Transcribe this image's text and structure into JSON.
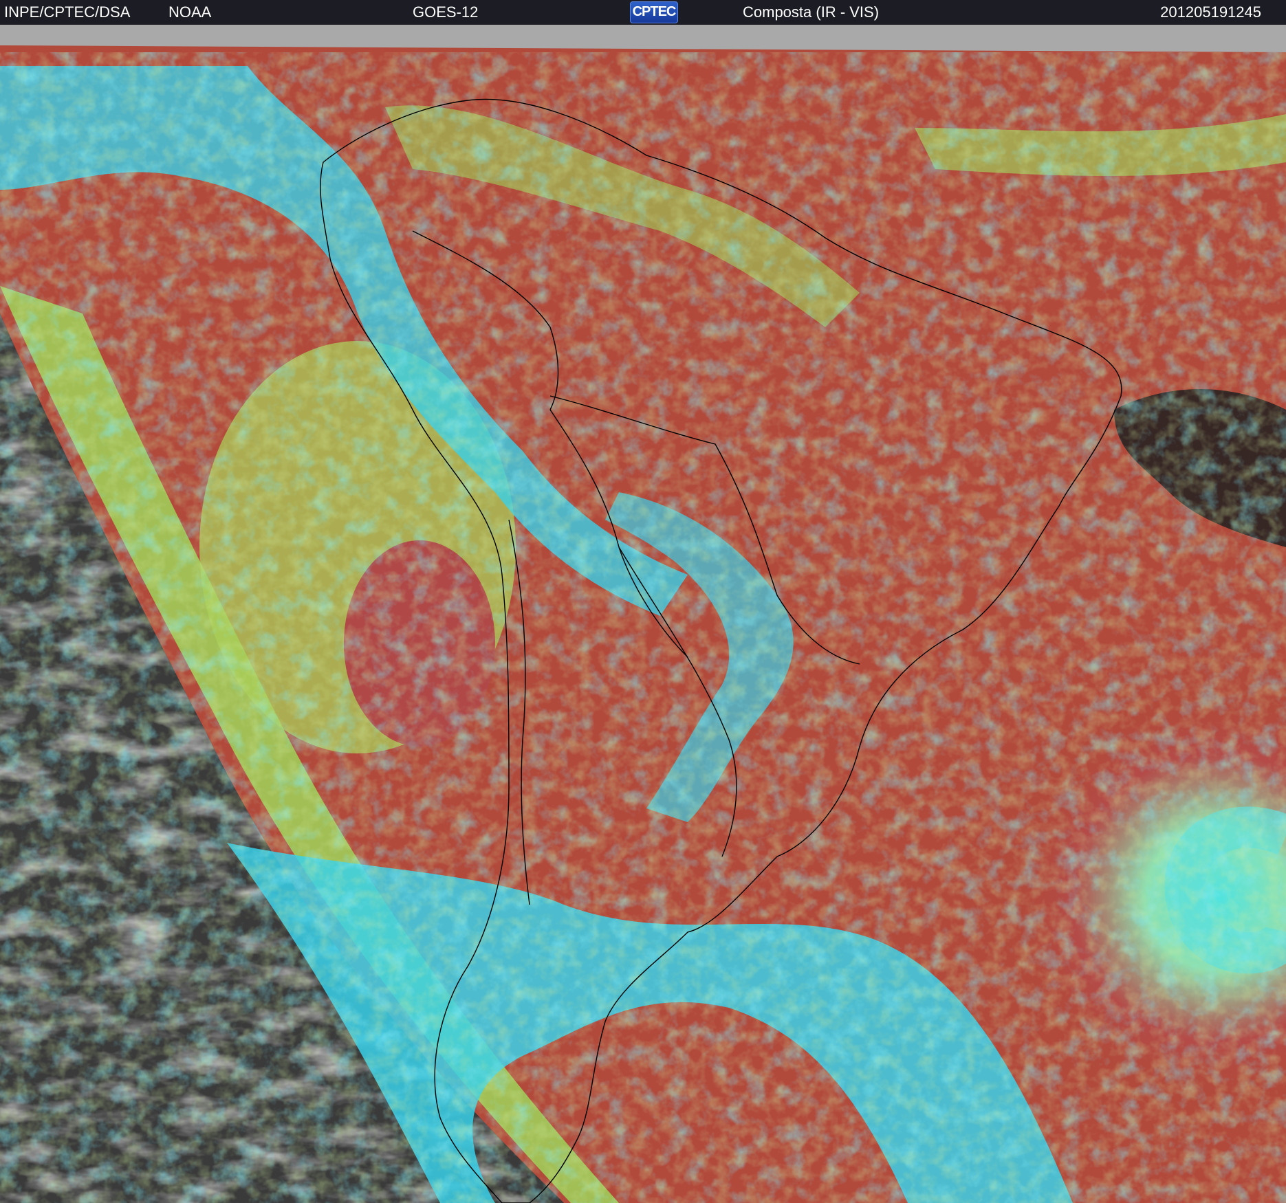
{
  "header": {
    "source": "INPE/CPTEC/DSA",
    "agency": "NOAA",
    "satellite": "GOES-12",
    "logo_text": "CPTEC",
    "product": "Composta (IR - VIS)",
    "timestamp": "201205191245"
  },
  "colors": {
    "header_bg": "#1c1d24",
    "header_text": "#ffffff",
    "space_gray": "#a9a9a9",
    "night_side": "#3a3a3a",
    "clear_sky": "#b24a3c",
    "low_cloud": "#9fd45a",
    "high_cloud": "#3ad0e8",
    "coastline": "#000000"
  }
}
